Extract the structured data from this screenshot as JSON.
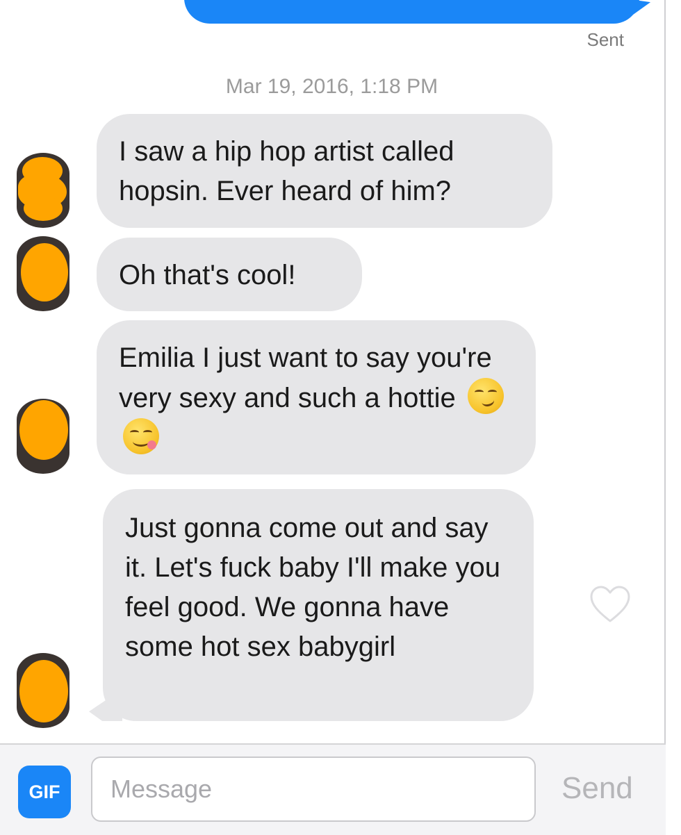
{
  "thread": {
    "last_sent_status": "Sent",
    "timestamp": "Mar 19, 2016, 1:18 PM"
  },
  "messages": [
    {
      "text": "I saw a hip hop artist called hopsin. Ever heard of him?"
    },
    {
      "text": "Oh that's cool!"
    },
    {
      "text": "Emilia I just want to say you're very sexy and such a hottie"
    },
    {
      "text": "Just gonna come out and say it. Let's fuck baby I'll make you feel good. We gonna have some hot sex babygirl"
    }
  ],
  "message_emojis": [
    "smirking-face",
    "face-savoring-food"
  ],
  "composer": {
    "gif_label": "GIF",
    "placeholder": "Message",
    "value": "",
    "send_label": "Send"
  },
  "colors": {
    "accent": "#1a86f7",
    "incoming_bubble": "#e6e6e8",
    "avatar_censor": "#ffa500"
  }
}
